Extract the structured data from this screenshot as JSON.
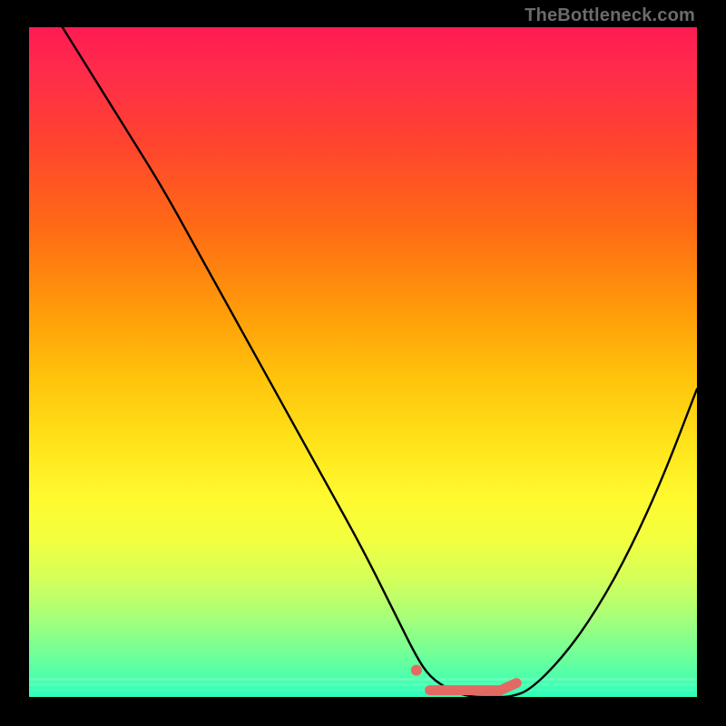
{
  "watermark": "TheBottleneck.com",
  "chart_data": {
    "type": "line",
    "title": "",
    "xlabel": "",
    "ylabel": "",
    "xlim": [
      0,
      100
    ],
    "ylim": [
      0,
      100
    ],
    "series": [
      {
        "name": "curve",
        "x": [
          5,
          10,
          15,
          20,
          25,
          30,
          35,
          40,
          45,
          50,
          55,
          58,
          60,
          63,
          66,
          70,
          72,
          75,
          80,
          85,
          90,
          95,
          100
        ],
        "y": [
          100,
          92,
          84,
          76,
          67,
          58,
          49,
          40,
          31,
          22,
          12,
          6,
          3,
          1,
          0,
          0,
          0,
          1,
          6,
          13,
          22,
          33,
          46
        ]
      }
    ],
    "markers": [
      {
        "name": "dot",
        "x": 58,
        "y": 4
      },
      {
        "name": "flat-segment",
        "x0": 60,
        "x1": 73,
        "y": 1
      }
    ],
    "marker_color": "#e26a63",
    "curve_color": "#000000",
    "background_gradient": [
      "#ff1b53",
      "#ffe31a",
      "#2fffbb"
    ]
  }
}
